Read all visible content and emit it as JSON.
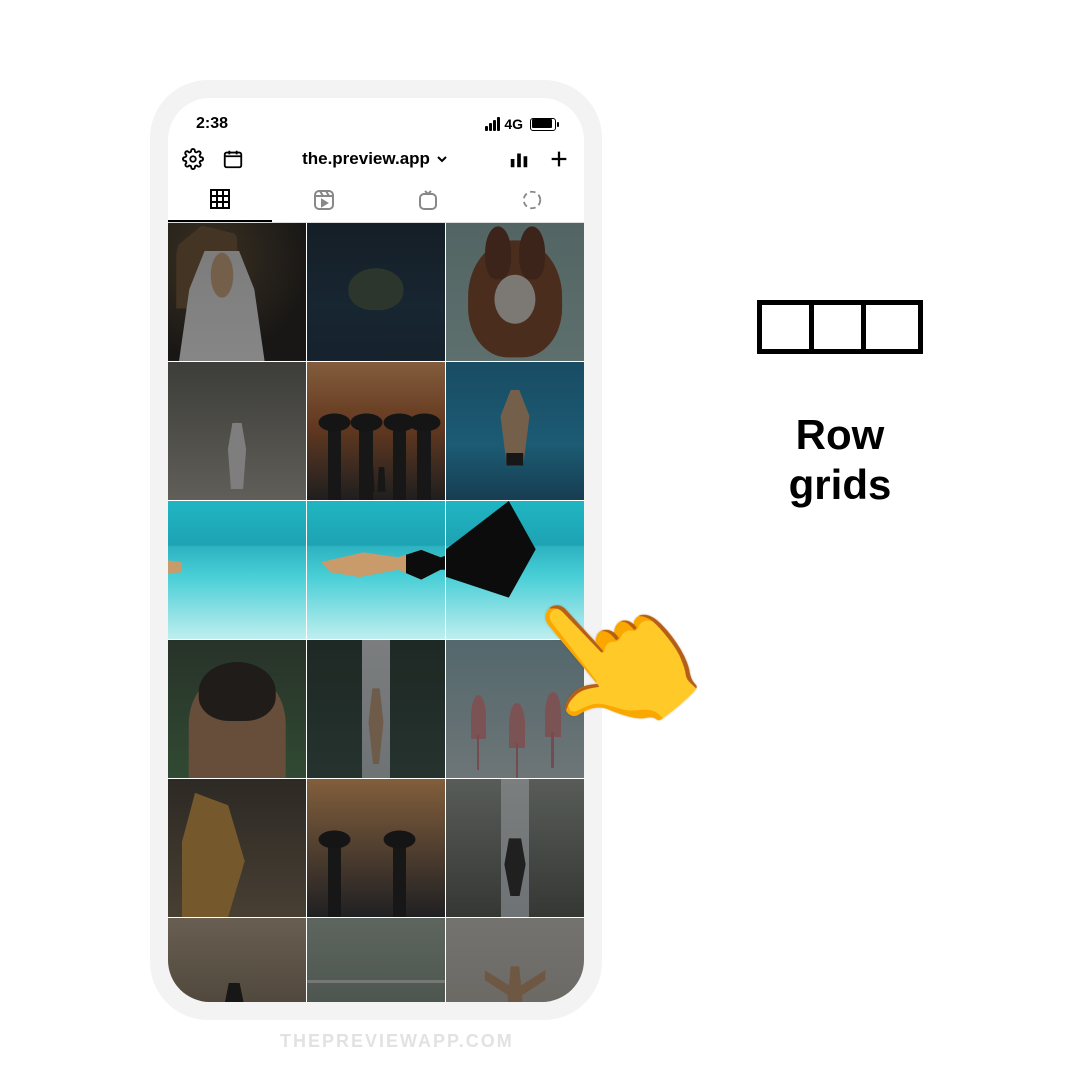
{
  "statusbar": {
    "time": "2:38",
    "network": "4G"
  },
  "topnav": {
    "username": "the.preview.app"
  },
  "tabs": [
    {
      "name": "grid",
      "active": true
    },
    {
      "name": "reels",
      "active": false
    },
    {
      "name": "igtv",
      "active": false
    },
    {
      "name": "loading",
      "active": false
    }
  ],
  "highlighted_row_index": 2,
  "label": {
    "line1": "Row",
    "line2": "grids"
  },
  "watermark": "THEPREVIEWAPP.COM",
  "hand_emoji": "👆"
}
